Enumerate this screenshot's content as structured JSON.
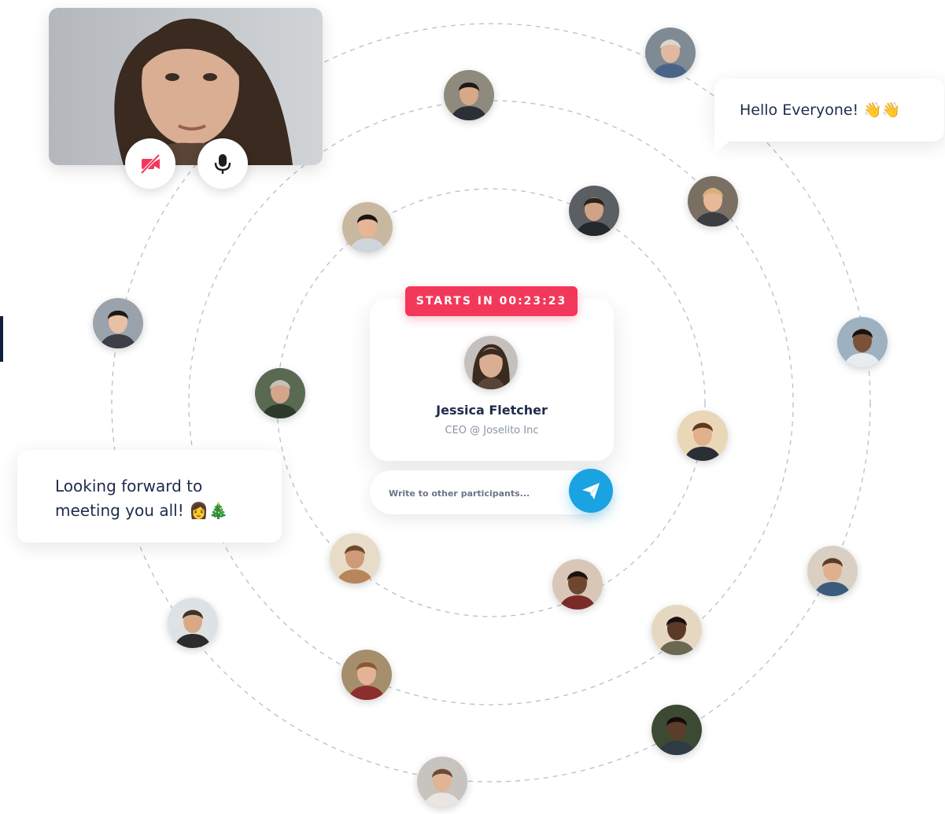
{
  "colors": {
    "accent_red": "#f2385a",
    "accent_blue": "#1aa3e0",
    "ring_stroke": "#b9bec8",
    "heading": "#1f2b4a"
  },
  "video_call": {
    "camera_button": {
      "icon": "camera-off-icon",
      "state": "off"
    },
    "mic_button": {
      "icon": "microphone-icon",
      "state": "on"
    }
  },
  "messages": {
    "right_bubble": "Hello Everyone! 👋👋",
    "left_bubble_line1": "Looking forward to",
    "left_bubble_line2": "meeting you all! 👩‍🎄"
  },
  "event": {
    "countdown_label": "STARTS IN 00:23:23",
    "host_name": "Jessica Fletcher",
    "host_role": "CEO @ Joselito Inc"
  },
  "chat": {
    "placeholder": "Write to other participants...",
    "send_icon": "paper-plane-icon"
  },
  "participants": [
    {
      "skin": "#e2b9a0",
      "hair": "#d8d6d0",
      "bg": "#7f8a94",
      "shirt": "#4a6488"
    },
    {
      "skin": "#d7a988",
      "hair": "#1d1a18",
      "bg": "#8e8a7e",
      "shirt": "#2c2f35"
    },
    {
      "skin": "#e8b999",
      "hair": "#d6b07a",
      "bg": "#7a6f63",
      "shirt": "#3b3d42"
    },
    {
      "skin": "#d1a385",
      "hair": "#2a221d",
      "bg": "#5b5e63",
      "shirt": "#25282d"
    },
    {
      "skin": "#e6b595",
      "hair": "#1a1614",
      "bg": "#c8b8a0",
      "shirt": "#cfd5da"
    },
    {
      "skin": "#e8c0a5",
      "hair": "#1b1917",
      "bg": "#9aa3ab",
      "shirt": "#3c3f47"
    },
    {
      "skin": "#7a5238",
      "hair": "#1a1310",
      "bg": "#9eb1c0",
      "shirt": "#e9ecef"
    },
    {
      "skin": "#d3a58a",
      "hair": "#c5c1bb",
      "bg": "#5a6a52",
      "shirt": "#2e3a2c"
    },
    {
      "skin": "#e3b08c",
      "hair": "#5c3a22",
      "bg": "#e9d7b8",
      "shirt": "#2b2f33"
    },
    {
      "skin": "#cf9a78",
      "hair": "#6b4a2e",
      "bg": "#e7dcc8",
      "shirt": "#b8865a"
    },
    {
      "skin": "#6e4630",
      "hair": "#1a120d",
      "bg": "#d8c7b6",
      "shirt": "#7b2a2a"
    },
    {
      "skin": "#e0b08e",
      "hair": "#5a3d27",
      "bg": "#d9cfc2",
      "shirt": "#3b5c7d"
    },
    {
      "skin": "#d9a985",
      "hair": "#3c342c",
      "bg": "#dfe2e4",
      "shirt": "#2c2c2e"
    },
    {
      "skin": "#5b3a28",
      "hair": "#161010",
      "bg": "#e6d8c0",
      "shirt": "#6b6852"
    },
    {
      "skin": "#e2b394",
      "hair": "#8a5a34",
      "bg": "#a58e6c",
      "shirt": "#8c2e2e"
    },
    {
      "skin": "#dfb497",
      "hair": "#6b4b35",
      "bg": "#c7c4c0",
      "shirt": "#e9e6e2"
    },
    {
      "skin": "#5c3c2a",
      "hair": "#120d0b",
      "bg": "#3d4a33",
      "shirt": "#2f3a44"
    }
  ]
}
